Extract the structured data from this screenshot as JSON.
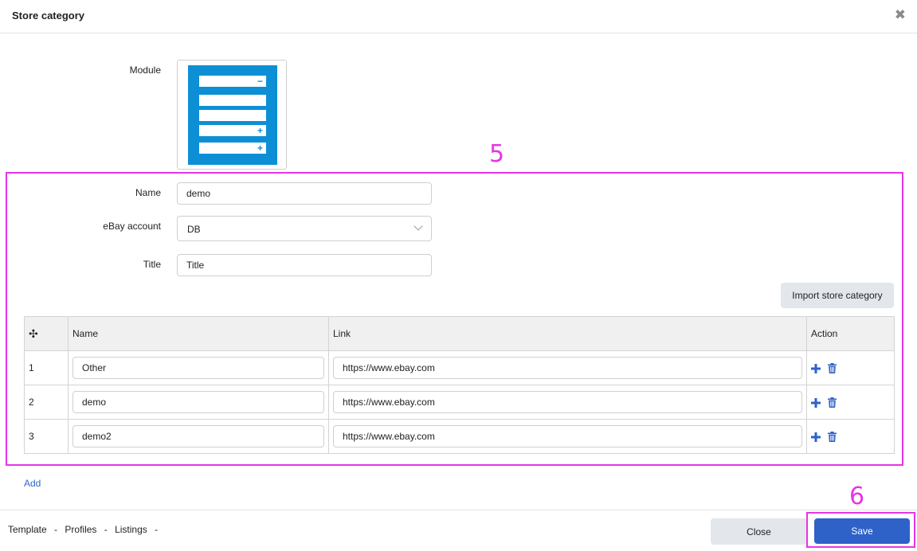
{
  "dialog": {
    "title": "Store category"
  },
  "form": {
    "module_label": "Module",
    "name_label": "Name",
    "name_value": "demo",
    "ebay_label": "eBay account",
    "ebay_value": "DB",
    "title_label": "Title",
    "title_value": "Title",
    "import_label": "Import store category"
  },
  "table": {
    "headers": {
      "move": "✣",
      "name": "Name",
      "link": "Link",
      "action": "Action"
    },
    "rows": [
      {
        "num": "1",
        "name": "Other",
        "link": "https://www.ebay.com"
      },
      {
        "num": "2",
        "name": "demo",
        "link": "https://www.ebay.com"
      },
      {
        "num": "3",
        "name": "demo2",
        "link": "https://www.ebay.com"
      }
    ]
  },
  "add_label": "Add",
  "annotations": {
    "a5": "5",
    "a6": "6"
  },
  "footer": {
    "links": [
      "Template",
      "Profiles",
      "Listings"
    ],
    "separator": "-",
    "close_label": "Close",
    "save_label": "Save"
  },
  "colors": {
    "accent": "#2e62c9",
    "annotation": "#e535e5",
    "module_blue": "#0d8fd6"
  },
  "icons": {
    "close": "close-icon",
    "move": "move-icon",
    "add": "plus-icon",
    "delete": "trash-icon"
  }
}
